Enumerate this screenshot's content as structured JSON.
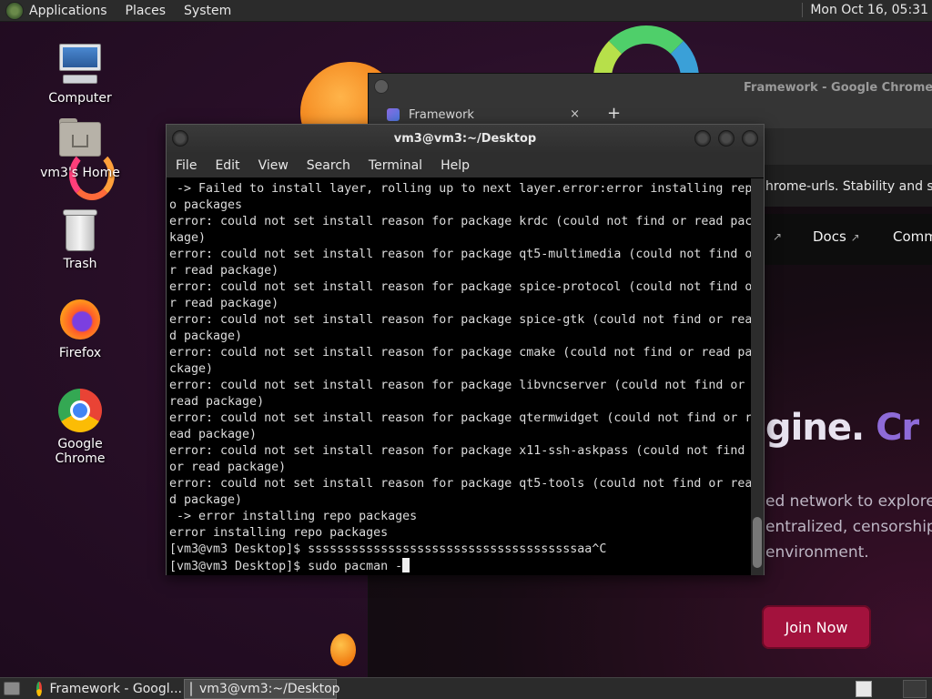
{
  "top_panel": {
    "menus": [
      "Applications",
      "Places",
      "System"
    ],
    "clock": "Mon Oct 16, 05:31"
  },
  "desktop_icons": [
    {
      "label": "Computer",
      "icon": "computer-icon"
    },
    {
      "label": "vm3's Home",
      "icon": "home-folder-icon"
    },
    {
      "label": "Trash",
      "icon": "trash-icon"
    },
    {
      "label": "Firefox",
      "icon": "firefox-icon"
    },
    {
      "label": "Google Chrome",
      "icon": "chrome-icon"
    }
  ],
  "chrome_window": {
    "title": "Framework - Google Chrome",
    "tab_label": "Framework",
    "tab_close": "×",
    "new_tab": "+",
    "info_text": "hrome-urls. Stability and secu",
    "nav_docs": "Docs",
    "nav_comm": "Comm",
    "headline_part1": "gine. ",
    "headline_part2": "Cr",
    "sub_lines": [
      "ed network to explore t",
      "entralized, censorship-",
      "environment."
    ],
    "join_button": "Join Now"
  },
  "terminal": {
    "title": "vm3@vm3:~/Desktop",
    "menus": [
      "File",
      "Edit",
      "View",
      "Search",
      "Terminal",
      "Help"
    ],
    "lines": [
      " -> Failed to install layer, rolling up to next layer.error:error installing repo packages",
      "error: could not set install reason for package krdc (could not find or read package)",
      "error: could not set install reason for package qt5-multimedia (could not find or read package)",
      "error: could not set install reason for package spice-protocol (could not find or read package)",
      "error: could not set install reason for package spice-gtk (could not find or read package)",
      "error: could not set install reason for package cmake (could not find or read package)",
      "error: could not set install reason for package libvncserver (could not find or read package)",
      "error: could not set install reason for package qtermwidget (could not find or read package)",
      "error: could not set install reason for package x11-ssh-askpass (could not find or read package)",
      "error: could not set install reason for package qt5-tools (could not find or read package)",
      " -> error installing repo packages",
      "error installing repo packages",
      "[vm3@vm3 Desktop]$ sssssssssssssssssssssssssssssssssssssaa^C",
      "[vm3@vm3 Desktop]$ sudo pacman -"
    ]
  },
  "taskbar": {
    "tasks": [
      {
        "label": "Framework - Googl...",
        "icon": "chrome-icon"
      },
      {
        "label": "vm3@vm3:~/Desktop",
        "icon": "terminal-icon"
      }
    ]
  }
}
